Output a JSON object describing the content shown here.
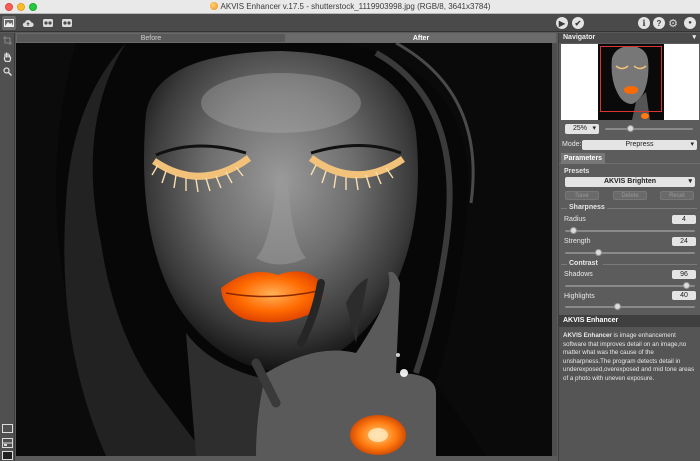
{
  "window": {
    "title": "AKVIS Enhancer v.17.5 - shutterstock_1119903998.jpg (RGB/8, 3641x3784)"
  },
  "toolbar": {
    "left_icons": [
      "image-mode-icon",
      "cloud-open-icon",
      "save-icon",
      "print-icon"
    ],
    "right_icons": [
      "run-icon",
      "apply-icon",
      "info-icon",
      "help-icon",
      "settings-icon",
      "notifications-icon"
    ],
    "run_glyph": "▶",
    "apply_glyph": "✔",
    "info_glyph": "i",
    "help_glyph": "?",
    "settings_glyph": "⚙",
    "notify_glyph": "●"
  },
  "tabs": {
    "before": "Before",
    "after": "After"
  },
  "navigator": {
    "title": "Navigator",
    "zoom": "25%"
  },
  "mode": {
    "label": "Mode:",
    "value": "Prepress"
  },
  "parameters": {
    "tab": "Parameters",
    "presets_label": "Presets",
    "preset_value": "AKVIS Brighten",
    "save": "Save",
    "delete": "Delete",
    "reset": "Reset",
    "sharpness_label": "Sharpness",
    "radius_label": "Radius",
    "radius_value": "4",
    "radius_fraction": 0.04,
    "strength_label": "Strength",
    "strength_value": "24",
    "strength_fraction": 0.24,
    "contrast_label": "Contrast",
    "shadows_label": "Shadows",
    "shadows_value": "96",
    "shadows_fraction": 0.96,
    "highlights_label": "Highlights",
    "highlights_value": "40",
    "highlights_fraction": 0.4
  },
  "description": {
    "title": "AKVIS Enhancer",
    "text_bold": "AKVIS Enhancer",
    "text": " is image enhancement software that improves detail on an image,no matter what was the cause of the unsharpness.The program detects detail in underexposed,overexposed and mid tone areas of a photo with uneven exposure."
  },
  "colors": {
    "accent_lips": "#ff6a00",
    "lashes": "#f3c27a"
  }
}
